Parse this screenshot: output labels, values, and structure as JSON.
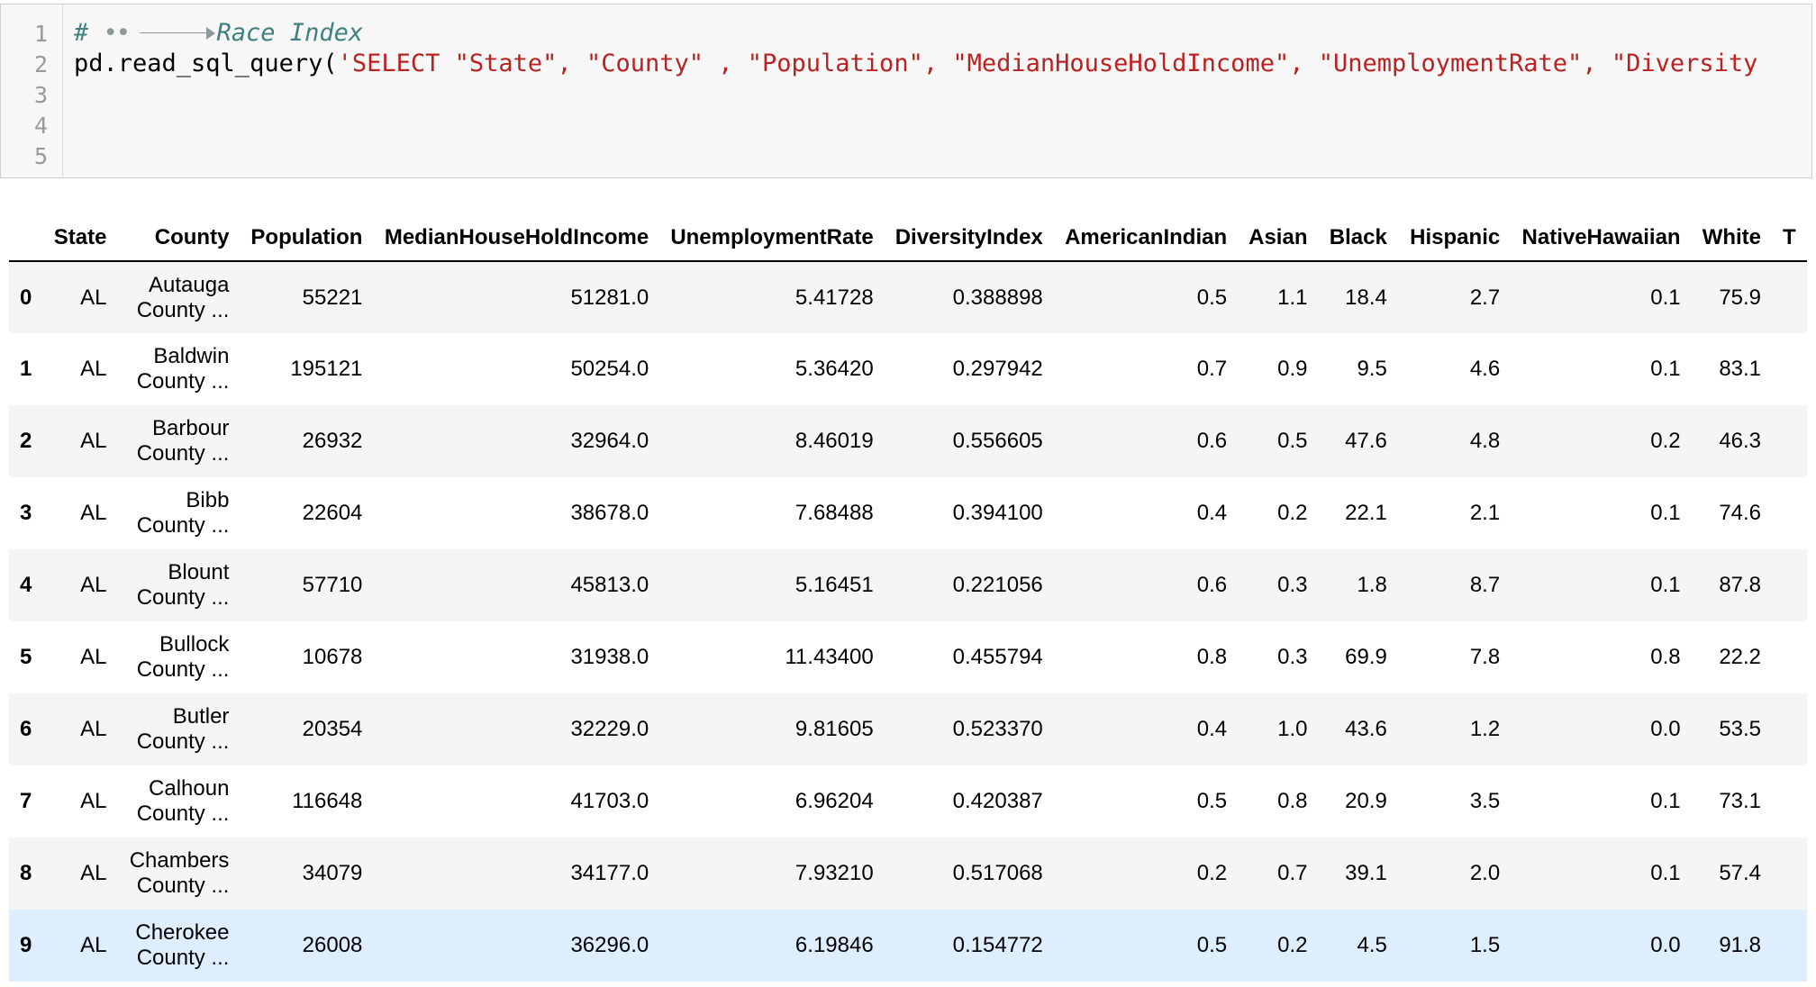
{
  "code_cell": {
    "line_numbers": [
      "1",
      "2",
      "3",
      "4",
      "5"
    ],
    "comment_hash": "#",
    "comment_text": "Race Index",
    "line2_func": "pd.read_sql_query(",
    "line2_string": "'SELECT \"State\", \"County\" , \"Population\", \"MedianHouseHoldIncome\", \"UnemploymentRate\", \"Diversity"
  },
  "table": {
    "columns": [
      "",
      "State",
      "County",
      "Population",
      "MedianHouseHoldIncome",
      "UnemploymentRate",
      "DiversityIndex",
      "AmericanIndian",
      "Asian",
      "Black",
      "Hispanic",
      "NativeHawaiian",
      "White",
      "T"
    ],
    "rows": [
      {
        "index": "0",
        "state": "AL",
        "county_1": "Autauga",
        "county_2": "County ...",
        "population": "55221",
        "income": "51281.0",
        "unemployment": "5.41728",
        "diversity": "0.388898",
        "american_indian": "0.5",
        "asian": "1.1",
        "black": "18.4",
        "hispanic": "2.7",
        "native_hawaiian": "0.1",
        "white": "75.9"
      },
      {
        "index": "1",
        "state": "AL",
        "county_1": "Baldwin",
        "county_2": "County ...",
        "population": "195121",
        "income": "50254.0",
        "unemployment": "5.36420",
        "diversity": "0.297942",
        "american_indian": "0.7",
        "asian": "0.9",
        "black": "9.5",
        "hispanic": "4.6",
        "native_hawaiian": "0.1",
        "white": "83.1"
      },
      {
        "index": "2",
        "state": "AL",
        "county_1": "Barbour",
        "county_2": "County ...",
        "population": "26932",
        "income": "32964.0",
        "unemployment": "8.46019",
        "diversity": "0.556605",
        "american_indian": "0.6",
        "asian": "0.5",
        "black": "47.6",
        "hispanic": "4.8",
        "native_hawaiian": "0.2",
        "white": "46.3"
      },
      {
        "index": "3",
        "state": "AL",
        "county_1": "Bibb",
        "county_2": "County ...",
        "population": "22604",
        "income": "38678.0",
        "unemployment": "7.68488",
        "diversity": "0.394100",
        "american_indian": "0.4",
        "asian": "0.2",
        "black": "22.1",
        "hispanic": "2.1",
        "native_hawaiian": "0.1",
        "white": "74.6"
      },
      {
        "index": "4",
        "state": "AL",
        "county_1": "Blount",
        "county_2": "County ...",
        "population": "57710",
        "income": "45813.0",
        "unemployment": "5.16451",
        "diversity": "0.221056",
        "american_indian": "0.6",
        "asian": "0.3",
        "black": "1.8",
        "hispanic": "8.7",
        "native_hawaiian": "0.1",
        "white": "87.8"
      },
      {
        "index": "5",
        "state": "AL",
        "county_1": "Bullock",
        "county_2": "County ...",
        "population": "10678",
        "income": "31938.0",
        "unemployment": "11.43400",
        "diversity": "0.455794",
        "american_indian": "0.8",
        "asian": "0.3",
        "black": "69.9",
        "hispanic": "7.8",
        "native_hawaiian": "0.8",
        "white": "22.2"
      },
      {
        "index": "6",
        "state": "AL",
        "county_1": "Butler",
        "county_2": "County ...",
        "population": "20354",
        "income": "32229.0",
        "unemployment": "9.81605",
        "diversity": "0.523370",
        "american_indian": "0.4",
        "asian": "1.0",
        "black": "43.6",
        "hispanic": "1.2",
        "native_hawaiian": "0.0",
        "white": "53.5"
      },
      {
        "index": "7",
        "state": "AL",
        "county_1": "Calhoun",
        "county_2": "County ...",
        "population": "116648",
        "income": "41703.0",
        "unemployment": "6.96204",
        "diversity": "0.420387",
        "american_indian": "0.5",
        "asian": "0.8",
        "black": "20.9",
        "hispanic": "3.5",
        "native_hawaiian": "0.1",
        "white": "73.1"
      },
      {
        "index": "8",
        "state": "AL",
        "county_1": "Chambers",
        "county_2": "County ...",
        "population": "34079",
        "income": "34177.0",
        "unemployment": "7.93210",
        "diversity": "0.517068",
        "american_indian": "0.2",
        "asian": "0.7",
        "black": "39.1",
        "hispanic": "2.0",
        "native_hawaiian": "0.1",
        "white": "57.4"
      },
      {
        "index": "9",
        "state": "AL",
        "county_1": "Cherokee",
        "county_2": "County ...",
        "population": "26008",
        "income": "36296.0",
        "unemployment": "6.19846",
        "diversity": "0.154772",
        "american_indian": "0.5",
        "asian": "0.2",
        "black": "4.5",
        "hispanic": "1.5",
        "native_hawaiian": "0.0",
        "white": "91.8"
      }
    ]
  }
}
